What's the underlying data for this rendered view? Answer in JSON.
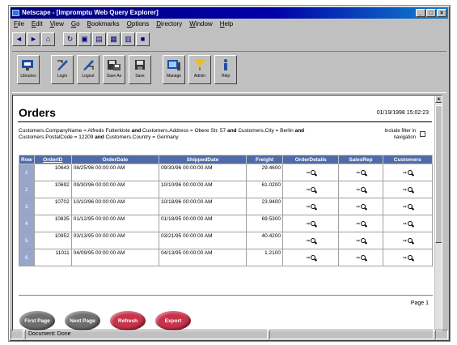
{
  "window": {
    "title": "Netscape - [Impromptu Web Query Explorer]",
    "buttons": [
      "_",
      "□",
      "×"
    ]
  },
  "menubar": [
    "File",
    "Edit",
    "View",
    "Go",
    "Bookmarks",
    "Options",
    "Directory",
    "Window",
    "Help"
  ],
  "nav_toolbar": [
    {
      "icon": "back-icon",
      "glyph": "◄"
    },
    {
      "icon": "forward-icon",
      "glyph": "►"
    },
    {
      "icon": "home-icon",
      "glyph": "⌂"
    },
    {
      "icon": "reload-icon",
      "glyph": "↻"
    },
    {
      "icon": "images-icon",
      "glyph": "▣"
    },
    {
      "icon": "open-icon",
      "glyph": "▤"
    },
    {
      "icon": "print-icon",
      "glyph": "▦"
    },
    {
      "icon": "find-icon",
      "glyph": "▥"
    },
    {
      "icon": "stop-icon",
      "glyph": "■"
    }
  ],
  "app_toolbar": [
    {
      "name": "toolbar-button-libraries",
      "label": "Libraries",
      "icon": "libraries-icon"
    },
    {
      "name": "toolbar-button-login",
      "label": "Login",
      "icon": "login-icon"
    },
    {
      "name": "toolbar-button-logout",
      "label": "Logout",
      "icon": "logout-icon"
    },
    {
      "name": "toolbar-button-save-as",
      "label": "Save As",
      "icon": "save-as-icon"
    },
    {
      "name": "toolbar-button-save",
      "label": "Save",
      "icon": "save-icon"
    },
    {
      "name": "toolbar-button-manage",
      "label": "Manage",
      "icon": "manage-icon"
    },
    {
      "name": "toolbar-button-admin",
      "label": "Admin",
      "icon": "admin-icon"
    },
    {
      "name": "toolbar-button-help",
      "label": "Help",
      "icon": "help-icon"
    }
  ],
  "page": {
    "title": "Orders",
    "timestamp": "01/19/1998 15:02:23",
    "filter_parts": [
      {
        "t": "Customers.CompanyName = Alfreds Futterkiste ",
        "b": false
      },
      {
        "t": "and",
        "b": true
      },
      {
        "t": " Customers.Address = Obere Str. 57 ",
        "b": false
      },
      {
        "t": "and",
        "b": true
      },
      {
        "t": " Customers.City = Berlin ",
        "b": false
      },
      {
        "t": "and",
        "b": true
      },
      {
        "t": " Customers.PostalCode = 12209 ",
        "b": false
      },
      {
        "t": "and",
        "b": true
      },
      {
        "t": " Customers.Country = Germany",
        "b": false
      }
    ],
    "include_filter_label": "Include filter in navigation",
    "page_label": "Page 1"
  },
  "table": {
    "headers": [
      "Row",
      "OrderID",
      "OrderDate",
      "ShippedDate",
      "Freight",
      "OrderDetails",
      "SalesRep",
      "Customers"
    ],
    "rows": [
      {
        "row": "1",
        "order_id": "10643",
        "order_date": "08/25/96 00:00:00 AM",
        "shipped_date": "09/30/96 00:00:00 AM",
        "freight": "29.4600"
      },
      {
        "row": "2",
        "order_id": "10692",
        "order_date": "09/30/96 00:00:00 AM",
        "shipped_date": "10/10/96 00:00:00 AM",
        "freight": "61.0200"
      },
      {
        "row": "3",
        "order_id": "10702",
        "order_date": "10/10/96 00:00:00 AM",
        "shipped_date": "10/18/96 00:00:00 AM",
        "freight": "23.9400"
      },
      {
        "row": "4",
        "order_id": "10835",
        "order_date": "01/12/95 00:00:00 AM",
        "shipped_date": "01/18/95 00:00:00 AM",
        "freight": "69.5300"
      },
      {
        "row": "5",
        "order_id": "10952",
        "order_date": "03/13/95 00:00:00 AM",
        "shipped_date": "03/21/95 00:00:00 AM",
        "freight": "40.4200"
      },
      {
        "row": "6",
        "order_id": "11011",
        "order_date": "04/09/95 00:00:00 AM",
        "shipped_date": "04/13/95 00:00:00 AM",
        "freight": "1.2100"
      }
    ],
    "link_arrow": "⇒"
  },
  "bottom_buttons": [
    {
      "name": "first-page-button",
      "label": "First Page",
      "style": "grey"
    },
    {
      "name": "next-page-button",
      "label": "Next Page",
      "style": "grey"
    },
    {
      "name": "refresh-button",
      "label": "Refresh",
      "style": "red"
    },
    {
      "name": "export-button",
      "label": "Export",
      "style": "red"
    }
  ],
  "status": {
    "text": "Document: Done"
  },
  "colors": {
    "title_bar": "#00007b",
    "table_header": "#506ca8",
    "row_number_bg": "#98a6cc",
    "nav_button": "#6e6e6e",
    "action_button": "#c8324a"
  }
}
